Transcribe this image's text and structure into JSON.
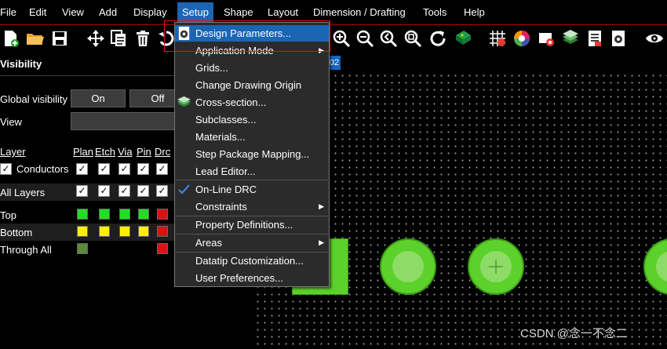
{
  "menubar": {
    "items": [
      "File",
      "Edit",
      "View",
      "Add",
      "Display",
      "Setup",
      "Shape",
      "Layout",
      "Dimension / Drafting",
      "Tools",
      "Help"
    ],
    "active": "Setup"
  },
  "toolbar": {
    "icons": [
      "new-file-icon",
      "open-folder-icon",
      "save-icon",
      "move-icon",
      "copy-icon",
      "delete-icon",
      "undo-icon",
      "zoom-in-icon",
      "zoom-out-icon",
      "zoom-previous-icon",
      "zoom-fit-icon",
      "redraw-icon",
      "board-icon",
      "grid-icon",
      "color-icon",
      "layer-icon",
      "stack-icon",
      "report-icon",
      "settings-icon",
      "visibility-eye-icon"
    ]
  },
  "panel": {
    "title": "Visibility",
    "global_visibility_label": "Global visibility",
    "on_label": "On",
    "off_label": "Off",
    "view_label": "View",
    "columns": {
      "layer": "Layer",
      "plan": "Plan",
      "etch": "Etch",
      "via": "Via",
      "pin": "Pin",
      "drc": "Drc"
    },
    "conductors_label": "Conductors",
    "all_layers_label": "All Layers",
    "rows": [
      {
        "name": "Top",
        "colors": [
          "#22dd22",
          "#22dd22",
          "#22dd22",
          "#22dd22",
          "#dd1111"
        ]
      },
      {
        "name": "Bottom",
        "colors": [
          "#ffee00",
          "#ffee00",
          "#ffee00",
          "#ffee00",
          "#dd1111"
        ]
      },
      {
        "name": "Through All",
        "colors": [
          "#5a8a3a",
          "",
          "",
          "",
          "#dd1111"
        ]
      }
    ]
  },
  "canvas": {
    "tab_fragment": "02"
  },
  "dropdown": {
    "items": [
      {
        "label": "Design Parameters...",
        "icon": "design-parameters-icon",
        "highlighted": true
      },
      {
        "label": "Application Mode",
        "submenu": true
      },
      {
        "label": "Grids..."
      },
      {
        "label": "Change Drawing Origin"
      },
      {
        "label": "Cross-section...",
        "icon": "cross-section-icon"
      },
      {
        "label": "Subclasses..."
      },
      {
        "label": "Materials..."
      },
      {
        "label": "Step Package Mapping..."
      },
      {
        "label": "Lead Editor..."
      },
      {
        "label": "On-Line DRC",
        "checked": true
      },
      {
        "label": "Constraints",
        "submenu": true
      },
      {
        "label": "Property Definitions..."
      },
      {
        "label": "Areas",
        "submenu": true
      },
      {
        "label": "Datatip Customization..."
      },
      {
        "label": "User Preferences..."
      }
    ]
  },
  "watermark": "CSDN @念一不念二",
  "colors": {
    "accent": "#1b65b3",
    "pad_green": "#5cd12b",
    "highlight_box": "#e0141e"
  }
}
